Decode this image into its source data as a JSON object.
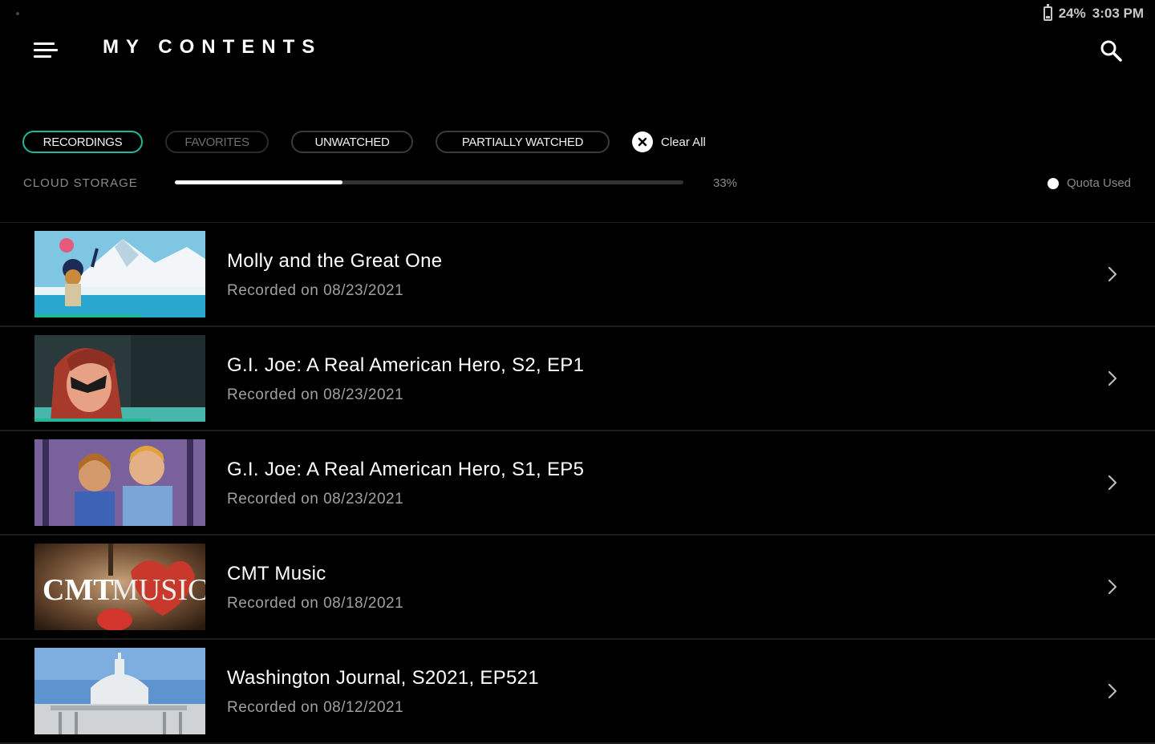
{
  "status_bar": {
    "battery": "24%",
    "time": "3:03 PM"
  },
  "header": {
    "title": "MY CONTENTS"
  },
  "filters": {
    "chips": [
      {
        "label": "RECORDINGS",
        "active": true
      },
      {
        "label": "FAVORITES",
        "active": false
      },
      {
        "label": "UNWATCHED",
        "active": false
      },
      {
        "label": "PARTIALLY WATCHED",
        "active": false
      }
    ],
    "clear_all": "Clear All"
  },
  "storage": {
    "label": "CLOUD STORAGE",
    "used_fraction": 0.33,
    "percent_text": "33%",
    "legend": "Quota Used"
  },
  "recordings": [
    {
      "title": "Molly and the Great One",
      "subtitle": "Recorded on 08/23/2021",
      "watched_fraction": 0.62
    },
    {
      "title": "G.I. Joe: A Real American Hero, S2, EP1",
      "subtitle": "Recorded on 08/23/2021",
      "watched_fraction": 0.68
    },
    {
      "title": "G.I. Joe: A Real American Hero, S1, EP5",
      "subtitle": "Recorded on 08/23/2021",
      "watched_fraction": 0
    },
    {
      "title": "CMT Music",
      "subtitle": "Recorded on 08/18/2021",
      "watched_fraction": 0,
      "thumb_text_left": "CMT",
      "thumb_text_right": "MUSIC"
    },
    {
      "title": "Washington Journal, S2021, EP521",
      "subtitle": "Recorded on 08/12/2021",
      "watched_fraction": 0
    }
  ],
  "colors": {
    "accent": "#21b89a",
    "background": "#000000",
    "divider": "#1d1d1d"
  }
}
